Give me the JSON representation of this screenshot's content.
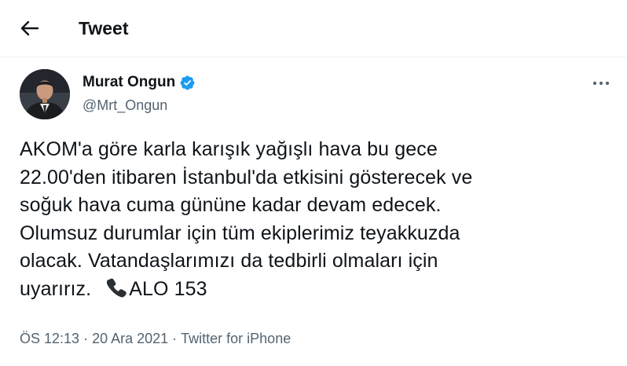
{
  "header": {
    "title": "Tweet"
  },
  "author": {
    "name": "Murat Ongun",
    "handle": "@Mrt_Ongun"
  },
  "tweet": {
    "lines": [
      "AKOM'a göre karla karışık yağışlı hava bu gece",
      "22.00'den itibaren İstanbul'da etkisini gösterecek ve",
      "soğuk hava cuma gününe kadar devam edecek.",
      "Olumsuz durumlar için tüm ekiplerimiz teyakkuzda",
      "olacak. Vatandaşlarımızı da tedbirli olmaları için",
      "uyarırız."
    ],
    "hotline": "ALO 153"
  },
  "meta": {
    "time": "ÖS 12:13",
    "separator": " · ",
    "date": "20 Ara 2021",
    "source": "Twitter for iPhone"
  },
  "colors": {
    "text": "#0f1419",
    "secondary": "#536471",
    "verified": "#1d9bf0",
    "divider": "#eff3f4"
  },
  "icons": {
    "back": "arrow-left-icon",
    "verified": "verified-badge-icon",
    "more": "more-horizontal-icon",
    "phone": "telephone-receiver-icon"
  }
}
